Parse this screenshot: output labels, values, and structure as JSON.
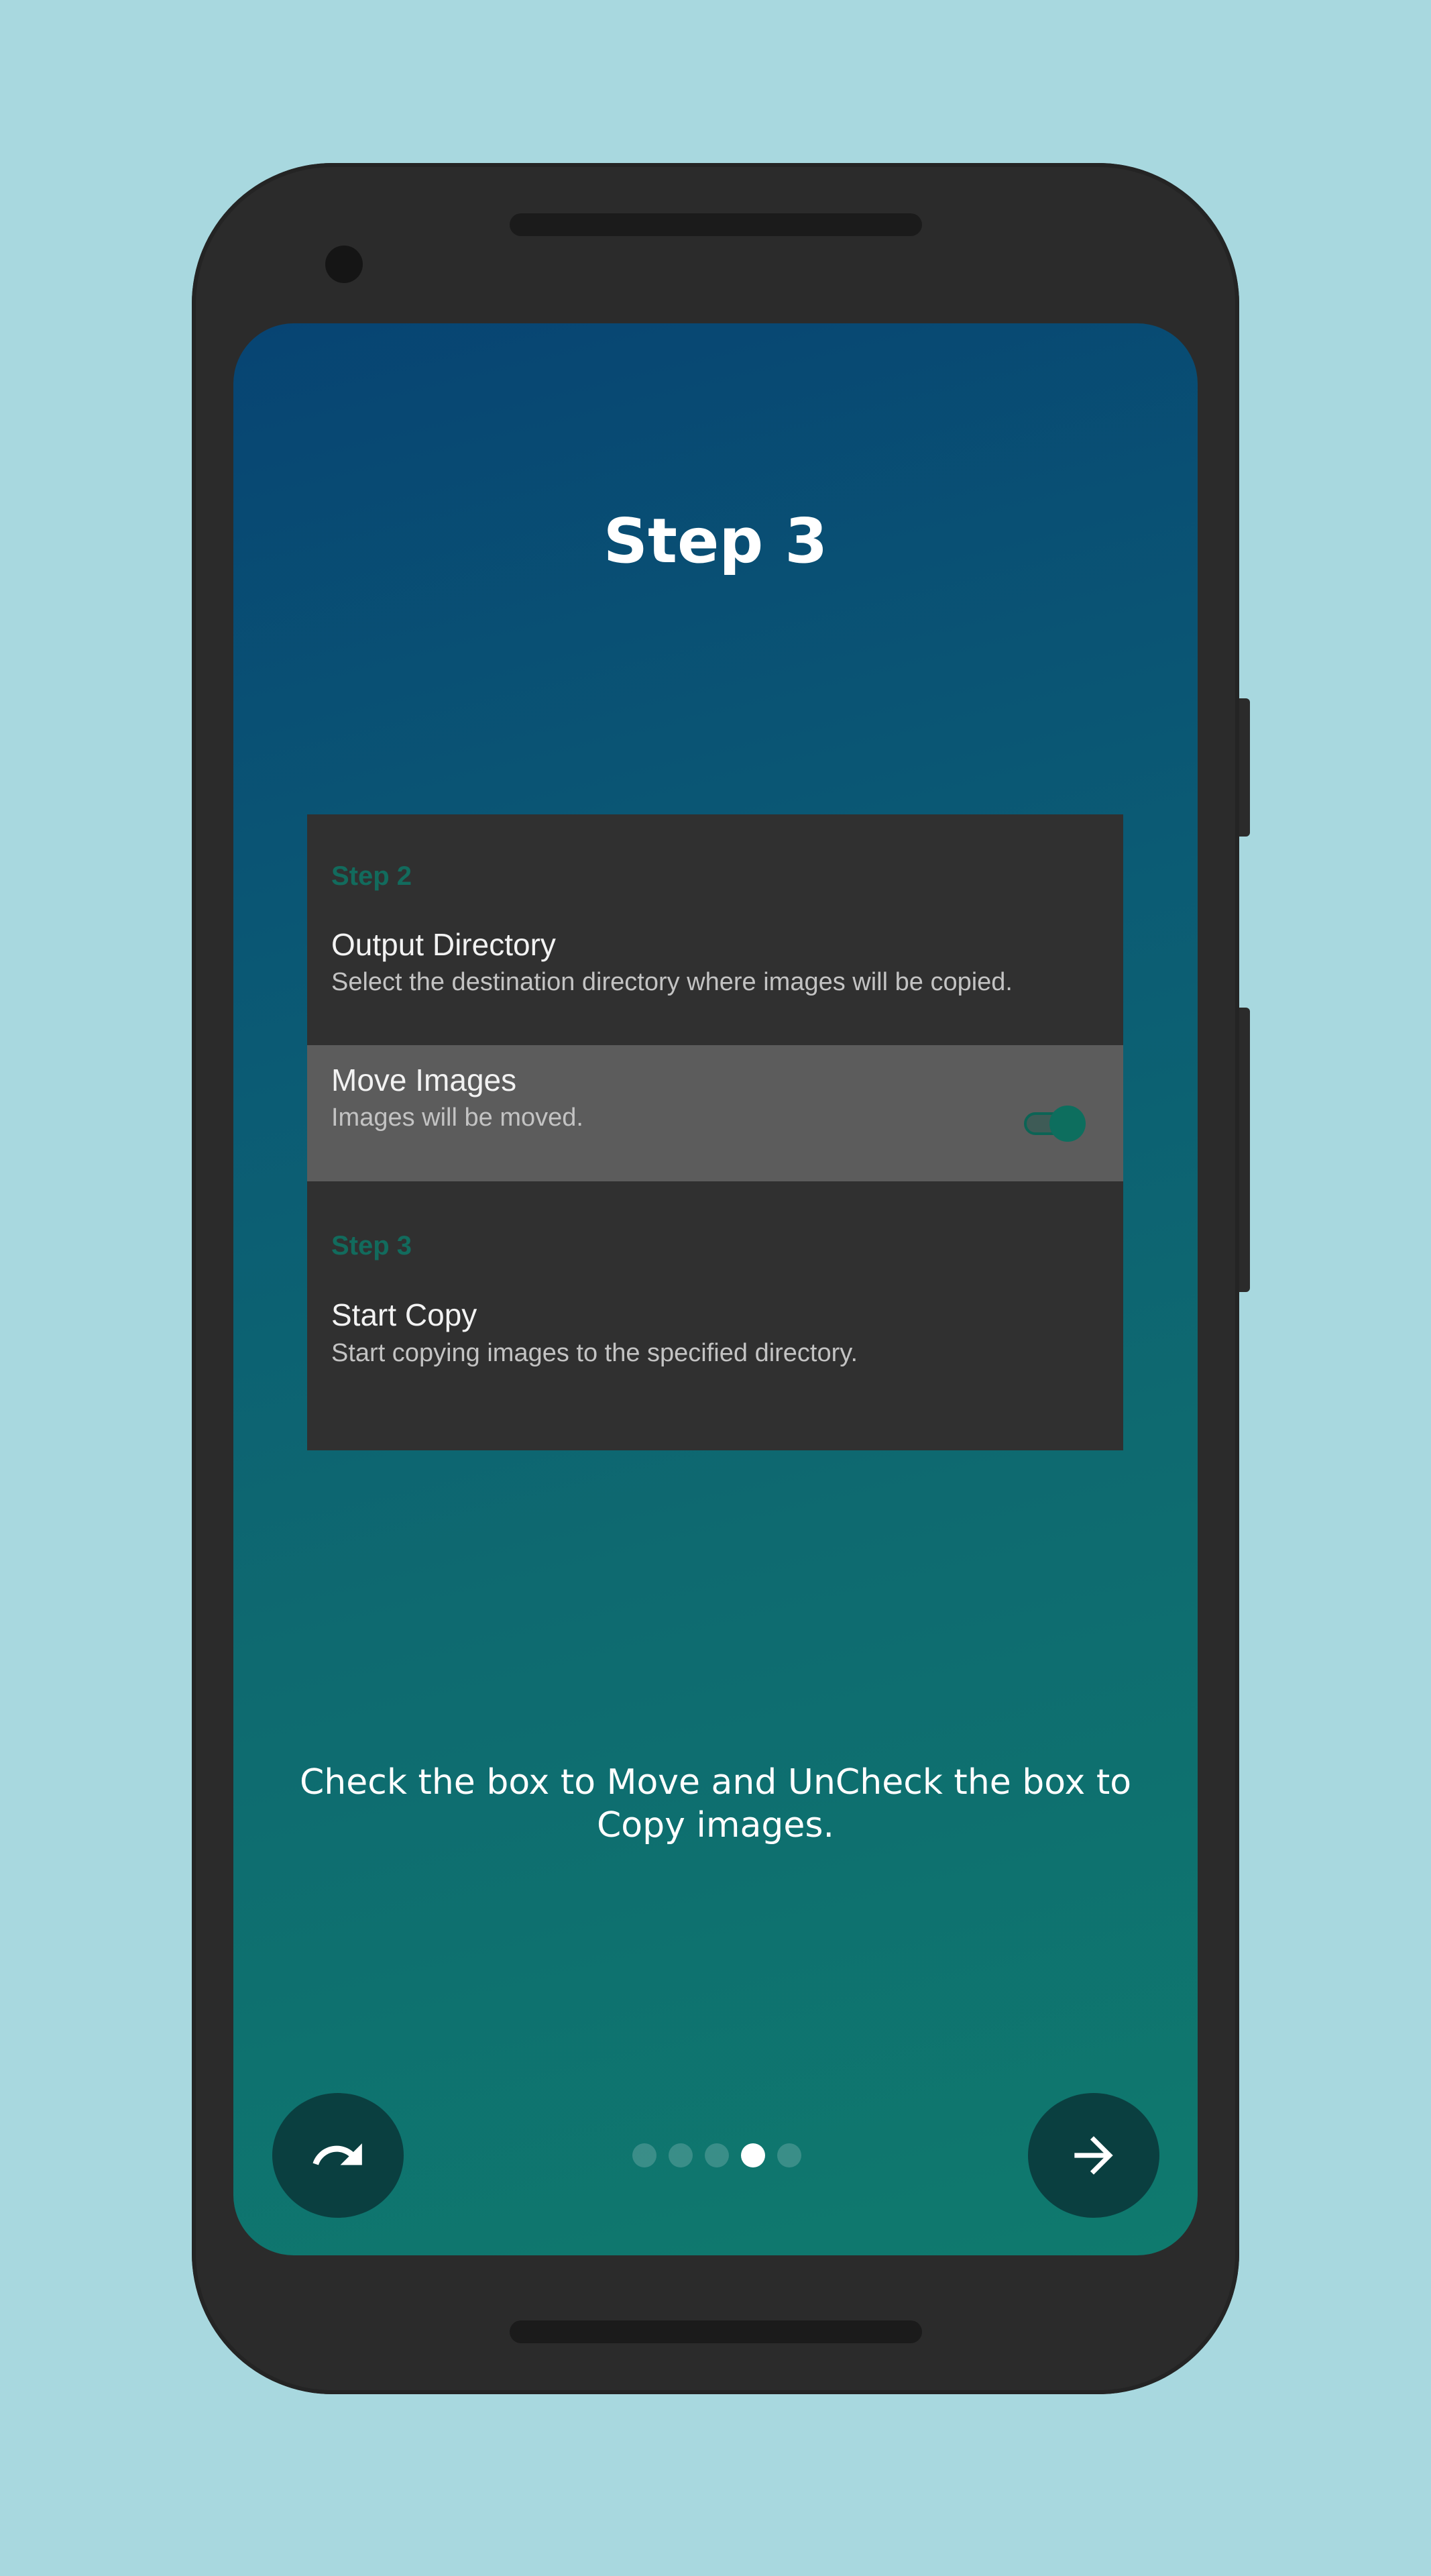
{
  "intro": {
    "title": "Step 3",
    "description": "Check the box to Move and UnCheck the box to Copy images.",
    "page_count": 5,
    "current_page": 4
  },
  "preview": {
    "group1_label": "Step 2",
    "output_title": "Output Directory",
    "output_summary": "Select the destination directory where images will be copied.",
    "move_title": "Move Images",
    "move_summary": "Images will be moved.",
    "move_enabled": true,
    "group2_label": "Step 3",
    "start_title": "Start Copy",
    "start_summary": "Start copying images to the specified directory."
  },
  "colors": {
    "background": "#a8d8df",
    "device_body": "#2b2b2b",
    "accent": "#0d6e5e",
    "fab": "#0a3f40"
  },
  "icons": {
    "skip_button": "redo-arrow-icon",
    "next_button": "arrow-right-icon"
  }
}
